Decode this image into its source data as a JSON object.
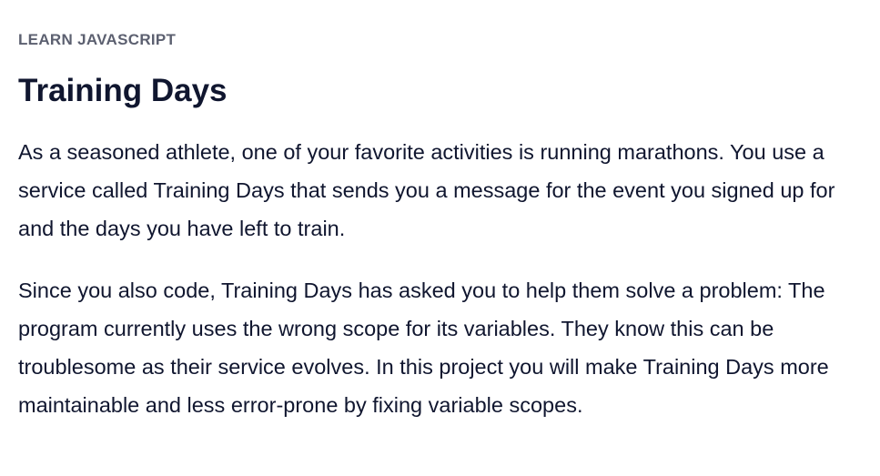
{
  "lesson": {
    "category": "LEARN JAVASCRIPT",
    "title": "Training Days",
    "paragraphs": [
      "As a seasoned athlete, one of your favorite activities is running marathons. You use a service called Training Days that sends you a message for the event you signed up for and the days you have left to train.",
      "Since you also code, Training Days has asked you to help them solve a problem: The program currently uses the wrong scope for its variables. They know this can be troublesome as their service evolves. In this project you will make Training Days more maintainable and less error-prone by fixing variable scopes."
    ]
  }
}
